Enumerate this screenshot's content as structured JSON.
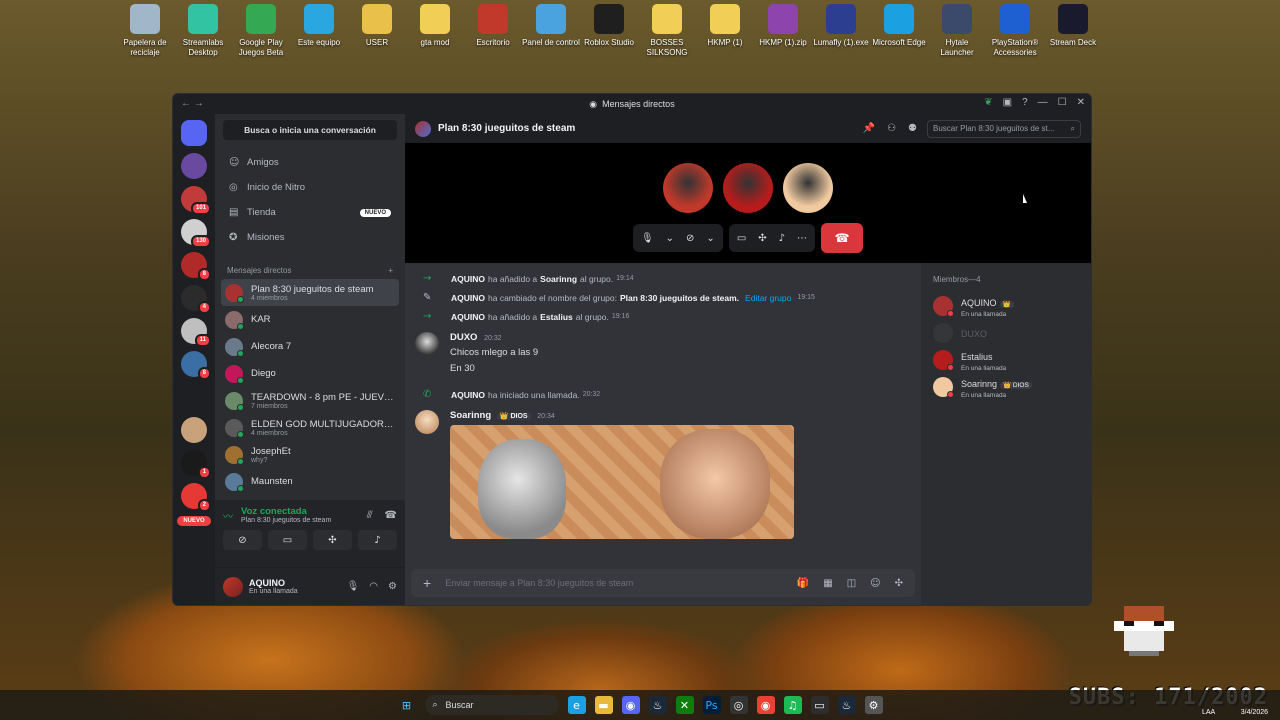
{
  "desktop": {
    "icons": [
      {
        "label": "Papelera de reciclaje",
        "icon": "recycle-bin-icon",
        "color": "#9fb7c8"
      },
      {
        "label": "Streamlabs Desktop",
        "icon": "streamlabs-icon",
        "color": "#31c3a2"
      },
      {
        "label": "Google Play Juegos Beta",
        "icon": "google-play-games-icon",
        "color": "#34a853"
      },
      {
        "label": "Este equipo",
        "icon": "computer-icon",
        "color": "#2aa7e0"
      },
      {
        "label": "USER",
        "icon": "user-folder-icon",
        "color": "#e8c04a"
      },
      {
        "label": "gta mod",
        "icon": "folder-icon",
        "color": "#f1cf57"
      },
      {
        "label": "Escritorio",
        "icon": "desktop-folder-icon",
        "color": "#c0392b"
      },
      {
        "label": "Panel de control",
        "icon": "control-panel-icon",
        "color": "#4aa3df"
      },
      {
        "label": "Roblox Studio",
        "icon": "roblox-studio-icon",
        "color": "#1f1f1f"
      },
      {
        "label": "BOSSES SILKSONG",
        "icon": "folder-icon",
        "color": "#f1cf57"
      },
      {
        "label": "HKMP (1)",
        "icon": "folder-icon",
        "color": "#f1cf57"
      },
      {
        "label": "HKMP (1).zip",
        "icon": "zip-icon",
        "color": "#8e44ad"
      },
      {
        "label": "Lumafly (1).exe",
        "icon": "lumafly-icon",
        "color": "#2c3e90"
      },
      {
        "label": "Microsoft Edge",
        "icon": "edge-icon",
        "color": "#1ba1e2"
      },
      {
        "label": "Hytale Launcher",
        "icon": "hytale-icon",
        "color": "#3b4a6b"
      },
      {
        "label": "PlayStation® Accessories",
        "icon": "playstation-icon",
        "color": "#1e5fd1"
      },
      {
        "label": "Stream Deck",
        "icon": "stream-deck-icon",
        "color": "#1a1a2e"
      }
    ]
  },
  "window": {
    "title": "Mensajes directos",
    "title_icon": "discord-icon"
  },
  "servers": [
    {
      "name": "discord-home",
      "color": "#5865f2",
      "badge": ""
    },
    {
      "name": "server-1",
      "color": "#6a4aa0",
      "badge": ""
    },
    {
      "name": "server-2",
      "color": "#c23b3b",
      "badge": "101"
    },
    {
      "name": "server-3",
      "color": "#d0d0d0",
      "badge": "130"
    },
    {
      "name": "server-4",
      "color": "#b02a2a",
      "badge": "8"
    },
    {
      "name": "server-5",
      "color": "#2b2b2b",
      "badge": "4"
    },
    {
      "name": "server-6",
      "color": "#bfbfbf",
      "badge": "11"
    },
    {
      "name": "server-7",
      "color": "#3a6ea5",
      "badge": "8"
    },
    {
      "name": "server-8",
      "color": "#1e1f22",
      "badge": ""
    },
    {
      "name": "server-9",
      "color": "#c8a27a",
      "badge": ""
    },
    {
      "name": "server-10",
      "color": "#1a1a1a",
      "badge": "1"
    },
    {
      "name": "server-11",
      "color": "#e53935",
      "badge": "2"
    }
  ],
  "servers_nuevo": "NUEVO",
  "dm_sidebar": {
    "search_label": "Busca o inicia una conversación",
    "nav": [
      {
        "label": "Amigos",
        "icon": "friends-icon",
        "glyph": "☺",
        "pill": ""
      },
      {
        "label": "Inicio de Nitro",
        "icon": "nitro-icon",
        "glyph": "◎",
        "pill": ""
      },
      {
        "label": "Tienda",
        "icon": "shop-icon",
        "glyph": "▤",
        "pill": "NUEVO"
      },
      {
        "label": "Misiones",
        "icon": "quests-icon",
        "glyph": "✪",
        "pill": ""
      }
    ],
    "dm_header": "Mensajes directos",
    "dm_add": "+",
    "dms": [
      {
        "name": "Plan 8:30 jueguitos de steam",
        "sub": "4 miembros",
        "color": "#a83232",
        "active": true
      },
      {
        "name": "KAR",
        "sub": "",
        "color": "#8a6a6a",
        "active": false
      },
      {
        "name": "Alecora 7",
        "sub": "",
        "color": "#6a7a8a",
        "active": false
      },
      {
        "name": "Diego",
        "sub": "",
        "color": "#c2185b",
        "active": false
      },
      {
        "name": "TEARDOWN - 8 pm PE - JUEVES",
        "sub": "7 miembros",
        "color": "#6a8a6a",
        "active": false
      },
      {
        "name": "ELDEN GOD MULTIJUGADOR 7...",
        "sub": "4 miembros",
        "color": "#5a5a5a",
        "active": false
      },
      {
        "name": "JosephEt",
        "sub": "why?",
        "color": "#a07030",
        "active": false
      },
      {
        "name": "Maunsten",
        "sub": "",
        "color": "#5a7a9a",
        "active": false
      }
    ]
  },
  "voice": {
    "title": "Voz conectada",
    "channel": "Plan 8:30 jueguitos de steam"
  },
  "user": {
    "name": "AQUINO",
    "status": "En una llamada"
  },
  "channel": {
    "name": "Plan 8:30 jueguitos de steam",
    "search_placeholder": "Buscar Plan 8:30 jueguitos de st..."
  },
  "call": {
    "participants": [
      {
        "name": "participant-1",
        "color": "#c0392b"
      },
      {
        "name": "participant-2",
        "color": "#b71c1c"
      },
      {
        "name": "participant-3",
        "color": "#f0c9a0"
      }
    ]
  },
  "messages": {
    "sys1": {
      "user": "AQUINO",
      "text": "ha añadido a",
      "target": "Soarinng",
      "tail": "al grupo.",
      "time": "19:14"
    },
    "sys2": {
      "user": "AQUINO",
      "text": "ha cambiado el nombre del grupo:",
      "target": "Plan 8:30 jueguitos de steam.",
      "link": "Editar grupo",
      "time": "19:15"
    },
    "sys3": {
      "user": "AQUINO",
      "text": "ha añadido a",
      "target": "Estalius",
      "tail": "al grupo.",
      "time": "19:16"
    },
    "duxo": {
      "author": "DUXO",
      "time": "20:32",
      "lines": [
        "Chicos mlego a las 9",
        "En 30"
      ]
    },
    "sys4": {
      "user": "AQUINO",
      "text": "ha iniciado una llamada.",
      "time": "20:32"
    },
    "soar": {
      "author": "Soarinng",
      "tag": "👑 DIOS",
      "time": "20:34"
    }
  },
  "composer": {
    "placeholder": "Enviar mensaje a Plan 8:30 jueguitos de steam"
  },
  "members": {
    "header": "Miembros—4",
    "list": [
      {
        "name": "AQUINO",
        "tag": "👑",
        "status": "En una llamada",
        "color": "#a83232",
        "offline": false
      },
      {
        "name": "DUXO",
        "tag": "",
        "status": "",
        "color": "#444",
        "offline": true
      },
      {
        "name": "Estalius",
        "tag": "",
        "status": "En una llamada",
        "color": "#b71c1c",
        "offline": false
      },
      {
        "name": "Soarinng",
        "tag": "👑 DIOS",
        "status": "En una llamada",
        "color": "#f0c9a0",
        "offline": false
      }
    ]
  },
  "taskbar": {
    "search": "Buscar",
    "lang": "LAA",
    "date": "3/4/2026"
  },
  "overlay": {
    "subs": "SUBS: 171/2002"
  }
}
